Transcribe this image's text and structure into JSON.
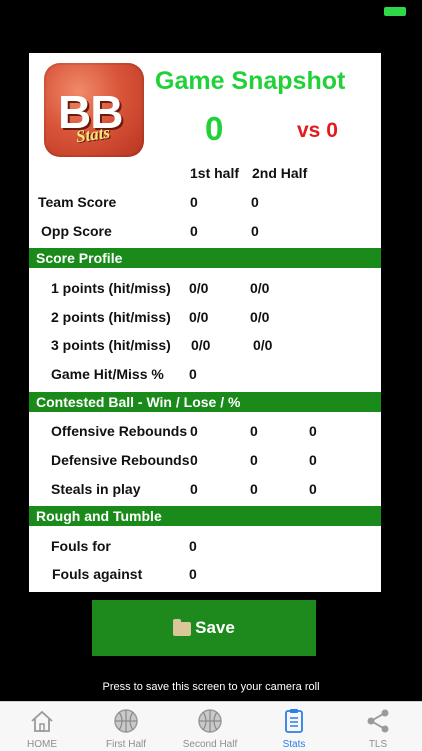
{
  "header": {
    "title": "Game Snapshot",
    "team_score": "0",
    "opp_score": "vs 0"
  },
  "logo": {
    "text": "BB",
    "subtext": "Stats"
  },
  "columns": {
    "first_half": "1st half",
    "second_half": "2nd Half"
  },
  "score_rows": [
    {
      "label": "Team Score",
      "first": "0",
      "second": "0"
    },
    {
      "label": "Opp Score",
      "first": "0",
      "second": "0"
    }
  ],
  "score_profile": {
    "header": "Score Profile",
    "rows": [
      {
        "label": "1 points (hit/miss)",
        "first": "0/0",
        "second": "0/0"
      },
      {
        "label": "2 points (hit/miss)",
        "first": "0/0",
        "second": "0/0"
      },
      {
        "label": "3 points (hit/miss)",
        "first": "0/0",
        "second": "0/0"
      },
      {
        "label": "Game Hit/Miss %",
        "first": "0"
      }
    ]
  },
  "contested": {
    "header": "Contested Ball - Win / Lose / %",
    "rows": [
      {
        "label": "Offensive Rebounds",
        "win": "0",
        "lose": "0",
        "pct": "0"
      },
      {
        "label": "Defensive Rebounds",
        "win": "0",
        "lose": "0",
        "pct": "0"
      },
      {
        "label": "Steals in play",
        "win": "0",
        "lose": "0",
        "pct": "0"
      }
    ]
  },
  "rough": {
    "header": "Rough and Tumble",
    "rows": [
      {
        "label": "Fouls for",
        "value": "0"
      },
      {
        "label": "Fouls against",
        "value": "0"
      }
    ]
  },
  "save": {
    "label": "Save",
    "hint": "Press to save this screen to your camera roll"
  },
  "tabs": [
    {
      "label": "HOME",
      "icon": "home-icon"
    },
    {
      "label": "First Half",
      "icon": "basketball-icon"
    },
    {
      "label": "Second Half",
      "icon": "basketball-icon"
    },
    {
      "label": "Stats",
      "icon": "clipboard-icon",
      "active": true
    },
    {
      "label": "TLS",
      "icon": "share-icon"
    }
  ],
  "colors": {
    "accent_green": "#22d13a",
    "section_green": "#1a8a1a",
    "opp_red": "#e21c1c",
    "active_tab": "#2d7ee6"
  }
}
